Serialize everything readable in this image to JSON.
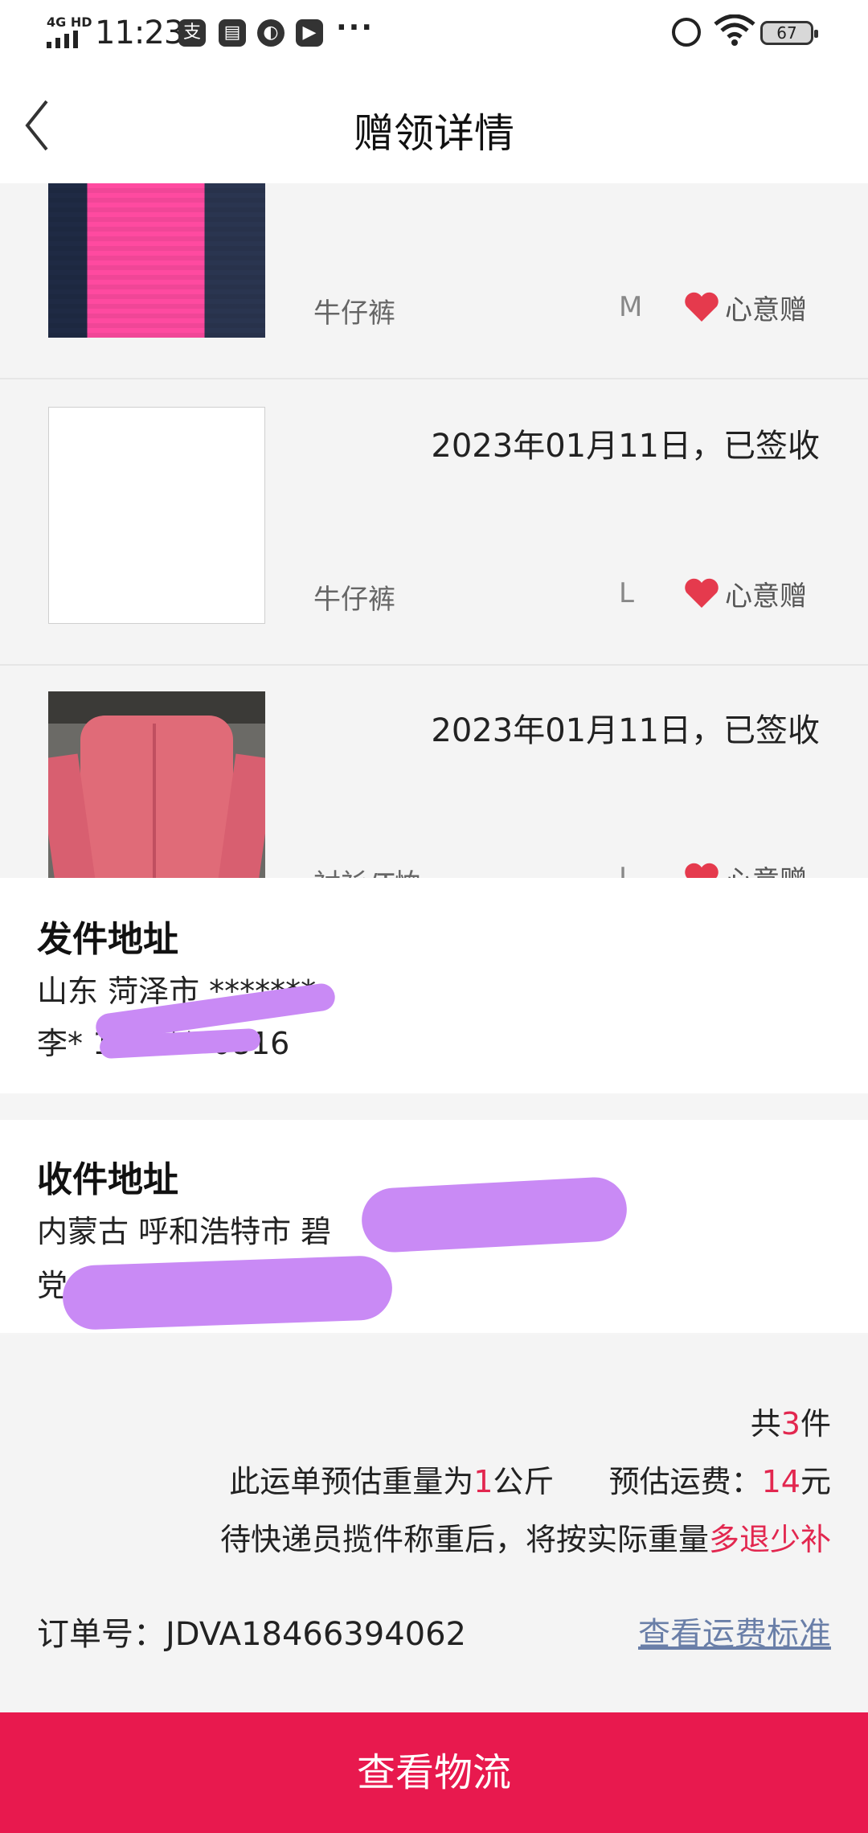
{
  "status_bar": {
    "network": "4G HD",
    "time": "11:23",
    "battery": "67",
    "app_icons": [
      "alipay-icon",
      "notes-icon",
      "compass-icon",
      "video-icon"
    ],
    "more": "···"
  },
  "header": {
    "title": "赠领详情"
  },
  "items": [
    {
      "image": "jeans-photo",
      "date": "",
      "category": "牛仔裤",
      "size": "M",
      "tag": "心意赠"
    },
    {
      "image": "blank-photo",
      "date": "2023年01月11日，已签收",
      "category": "牛仔裤",
      "size": "L",
      "tag": "心意赠"
    },
    {
      "image": "pink-shirt-photo",
      "date": "2023年01月11日，已签收",
      "category": "衬衫/T恤",
      "size": "L",
      "tag": "心意赠"
    }
  ],
  "sender": {
    "heading": "发件地址",
    "address": "山东 菏泽市 *******",
    "contact": "李* 176****0816"
  },
  "recipient": {
    "heading": "收件地址",
    "address": "内蒙古 呼和浩特市 碧",
    "contact": "党"
  },
  "summary": {
    "count_prefix": "共",
    "count": "3",
    "count_suffix": "件",
    "weight_prefix": "此运单预估重量为",
    "weight": "1",
    "weight_unit": "公斤",
    "fee_label": "预估运费：",
    "fee": "14",
    "fee_unit": "元",
    "note_prefix": "待快递员揽件称重后，将按实际重量",
    "note_highlight": "多退少补",
    "order_label": "订单号：",
    "order_number": "JDVA18466394062",
    "fee_standard_link": "查看运费标准"
  },
  "footer": {
    "button_label": "查看物流"
  },
  "colors": {
    "accent": "#e8194e",
    "highlight": "#e2274f",
    "link": "#6a7fa8",
    "redaction": "#c98af5",
    "heart": "#e53a4d"
  }
}
